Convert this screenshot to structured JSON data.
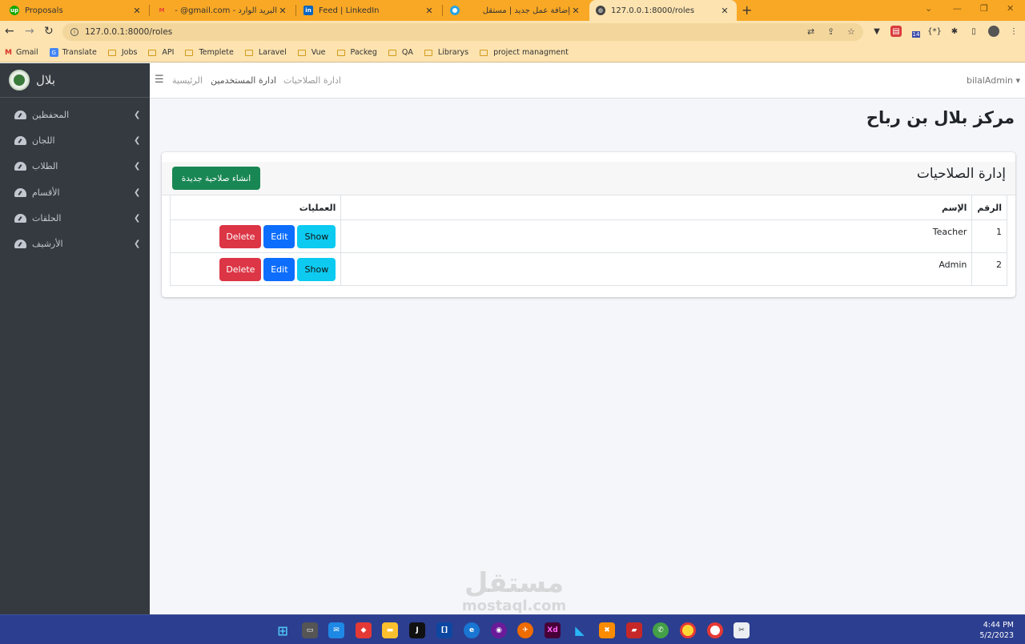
{
  "browser": {
    "tabs": [
      {
        "title": "Proposals",
        "icon": "upwork-icon",
        "color": "#14a800",
        "badge": "up"
      },
      {
        "title": "البريد الوارد - Gmail - @gmail.com",
        "icon": "gmail-icon",
        "color": "#ea4335",
        "badge": "M"
      },
      {
        "title": "Feed | LinkedIn",
        "icon": "linkedin-icon",
        "color": "#0a66c2",
        "badge": "in"
      },
      {
        "title": "إضافة عمل جديد | مستقل",
        "icon": "mostaql-icon",
        "color": "#2aa3e0",
        "badge": ""
      },
      {
        "title": "127.0.0.1:8000/roles",
        "icon": "globe-icon",
        "color": "#444444",
        "badge": ""
      }
    ],
    "new_tab": "+",
    "url": "127.0.0.1:8000/roles",
    "bookmarks": [
      "Gmail",
      "Translate",
      "Jobs",
      "API",
      "Templete",
      "Laravel",
      "Vue",
      "Packeg",
      "QA",
      "Librarys",
      "project managment"
    ],
    "extension_badge": "14",
    "window_controls": {
      "minimize": "⌄",
      "restore": "—",
      "maximize": "❐",
      "close": "✕"
    }
  },
  "sidebar": {
    "brand": "بلال",
    "items": [
      {
        "label": "المحفظين"
      },
      {
        "label": "اللجان"
      },
      {
        "label": "الطلاب"
      },
      {
        "label": "الأقسام"
      },
      {
        "label": "الحلقات"
      },
      {
        "label": "الأرشيف"
      }
    ]
  },
  "topnav": {
    "links": [
      {
        "label": "الرئيسية",
        "color": "#999999"
      },
      {
        "label": "ادارة المستخدمين",
        "color": "#555555"
      },
      {
        "label": "ادارة الصلاحيات",
        "color": "#999999"
      }
    ],
    "user": "bilalAdmin ▾"
  },
  "page": {
    "title": "مركز بلال بن رباح",
    "card_title": "إدارة الصلاحيات",
    "create_button": "انشاء صلاحية جديدة"
  },
  "table": {
    "headers": {
      "number": "الرقم",
      "name": "الإسم",
      "operations": "العمليات"
    },
    "rows": [
      {
        "number": "1",
        "name": "Teacher"
      },
      {
        "number": "2",
        "name": "Admin"
      }
    ],
    "buttons": {
      "delete": "Delete",
      "edit": "Edit",
      "show": "Show"
    }
  },
  "watermark": {
    "arabic": "مستقل",
    "latin": "mostaql.com"
  },
  "taskbar": {
    "time": "4:44 PM",
    "date": "5/2/2023"
  }
}
